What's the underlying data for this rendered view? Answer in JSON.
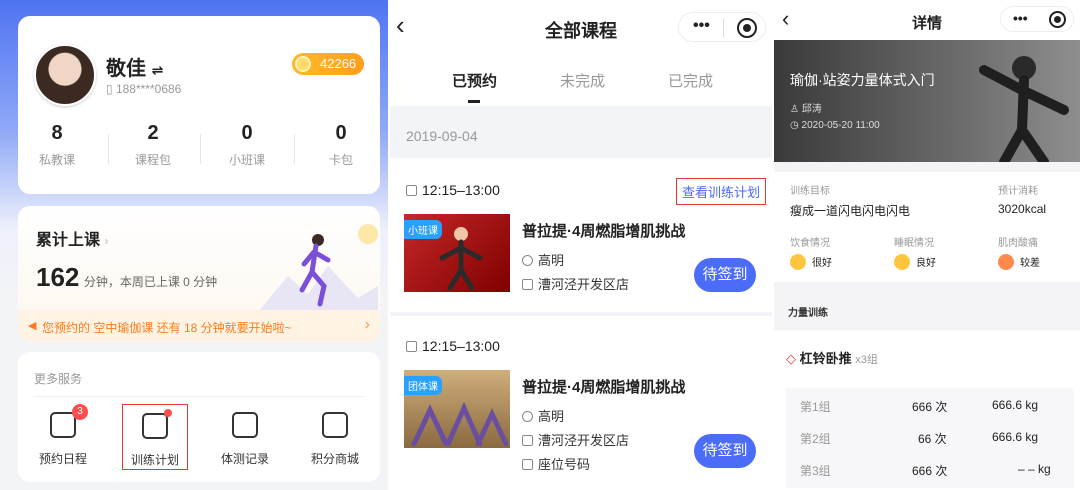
{
  "profile": {
    "name": "敬佳",
    "switch_icon": "⇌",
    "phone": "188****0686",
    "points": "42266",
    "stats": [
      {
        "value": "8",
        "label": "私教课"
      },
      {
        "value": "2",
        "label": "课程包"
      },
      {
        "value": "0",
        "label": "小班课"
      },
      {
        "value": "0",
        "label": "卡包"
      }
    ],
    "total_title": "累计上课",
    "total_minutes": "162",
    "total_desc": "分钟，本周已上课 0 分钟",
    "notice": "您预约的 空中瑜伽课 还有 18 分钟就要开始啦~",
    "more_title": "更多服务",
    "services": [
      {
        "label": "预约日程",
        "badge": "3",
        "icon": "calendar-icon"
      },
      {
        "label": "训练计划",
        "icon": "checklist-icon"
      },
      {
        "label": "体测记录",
        "icon": "chart-icon"
      },
      {
        "label": "积分商城",
        "icon": "store-icon"
      }
    ],
    "accent": "#4f74f2"
  },
  "courses": {
    "title": "全部课程",
    "tabs": [
      "已预约",
      "未完成",
      "已完成"
    ],
    "active_tab": "已预约",
    "date": "2019-09-04",
    "plan_link": "查看训练计划",
    "items": [
      {
        "time": "12:15–13:00",
        "tag": "小班课",
        "title": "普拉提·4周燃脂增肌挑战",
        "coach": "高明",
        "location": "漕河泾开发区店",
        "action": "待签到"
      },
      {
        "time": "12:15–13:00",
        "tag": "团体课",
        "title": "普拉提·4周燃脂增肌挑战",
        "coach": "高明",
        "location": "漕河泾开发区店",
        "seat": "座位号码",
        "action": "待签到"
      }
    ]
  },
  "detail": {
    "title": "详情",
    "course_title": "瑜伽·站姿力量体式入门",
    "coach": "邱涛",
    "datetime": "2020-05-20  11:00",
    "goal_label": "训练目标",
    "goal_value": "瘦成一道闪电闪电闪电",
    "cal_label": "预计消耗",
    "cal_value": "3020kcal",
    "diet_label": "饮食情况",
    "diet_value": "很好",
    "sleep_label": "睡眠情况",
    "sleep_value": "良好",
    "muscle_label": "肌肉酸痛",
    "muscle_value": "较差",
    "section": "力量训练",
    "exercise": "杠铃卧推",
    "sets_count": "x3组",
    "sets": [
      {
        "name": "第1组",
        "reps": "666 次",
        "weight": "666.6 kg"
      },
      {
        "name": "第2组",
        "reps": "66 次",
        "weight": "666.6 kg"
      },
      {
        "name": "第3组",
        "reps": "666 次",
        "weight": "– – kg"
      }
    ]
  }
}
